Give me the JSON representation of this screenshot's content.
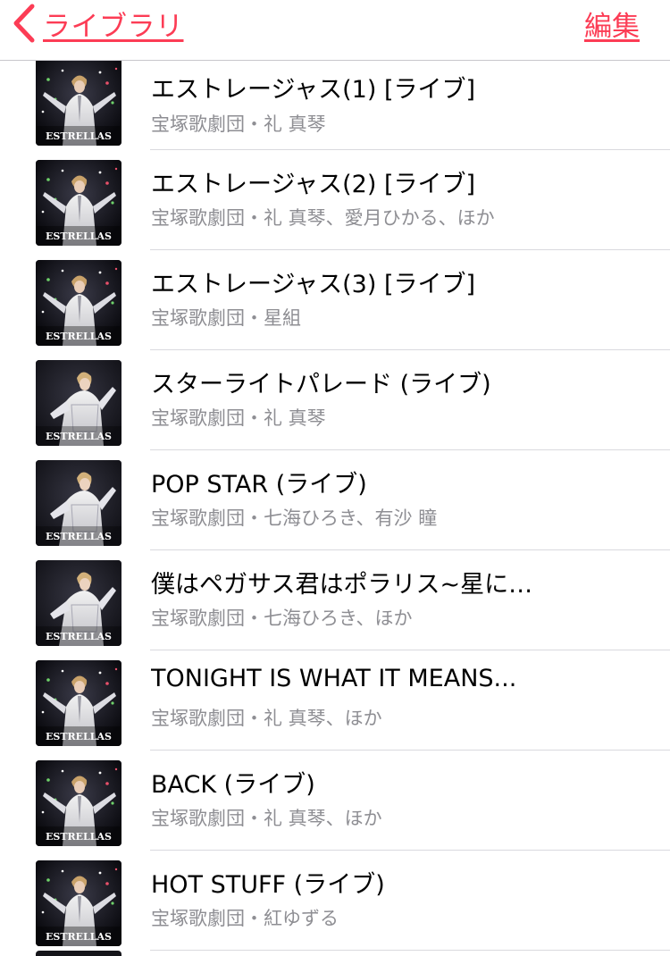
{
  "navbar": {
    "back_label": "ライブラリ",
    "edit_label": "編集",
    "accent_color": "#fc3c55",
    "back_icon": "chevron-left-icon"
  },
  "artwork": {
    "logo_text": "ESTRELLAS",
    "icon": "album-artwork"
  },
  "songs": [
    {
      "title": "エストレージャス(1) [ライブ]",
      "artist": "宝塚歌劇団・礼 真琴"
    },
    {
      "title": "エストレージャス(2) [ライブ]",
      "artist": "宝塚歌劇団・礼 真琴、愛月ひかる、ほか"
    },
    {
      "title": "エストレージャス(3) [ライブ]",
      "artist": "宝塚歌劇団・星組"
    },
    {
      "title": "スターライトパレード (ライブ)",
      "artist": "宝塚歌劇団・礼 真琴"
    },
    {
      "title": "POP STAR (ライブ)",
      "artist": "宝塚歌劇団・七海ひろき、有沙 瞳"
    },
    {
      "title": "僕はペガサス君はポラリス~星に…",
      "artist": "宝塚歌劇団・七海ひろき、ほか"
    },
    {
      "title": "TONIGHT IS WHAT IT MEANS...",
      "artist": "宝塚歌劇団・礼 真琴、ほか"
    },
    {
      "title": "BACK (ライブ)",
      "artist": "宝塚歌劇団・礼 真琴、ほか"
    },
    {
      "title": "HOT STUFF (ライブ)",
      "artist": "宝塚歌劇団・紅ゆずる"
    }
  ]
}
